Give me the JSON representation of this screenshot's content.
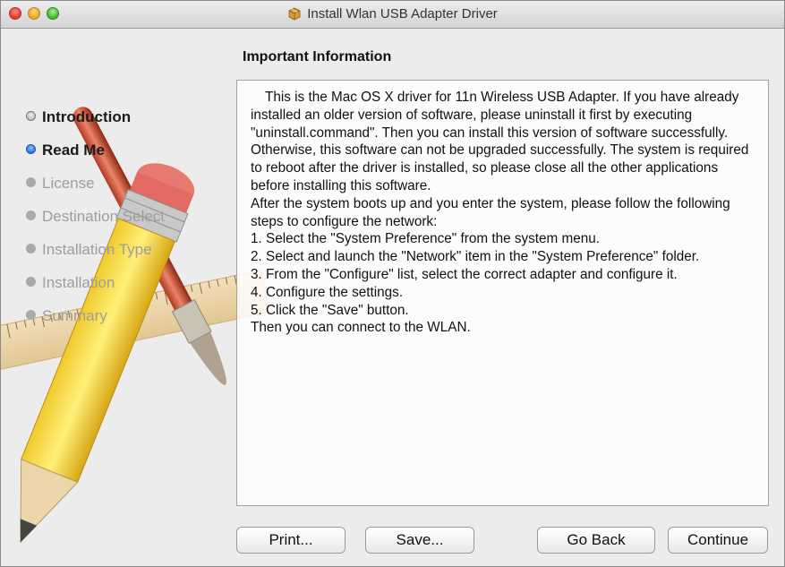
{
  "window": {
    "title": "Install Wlan USB Adapter Driver",
    "title_icon": "package-icon"
  },
  "heading": "Important Information",
  "steps": [
    {
      "label": "Introduction",
      "state": "done"
    },
    {
      "label": "Read Me",
      "state": "current"
    },
    {
      "label": "License",
      "state": "pending"
    },
    {
      "label": "Destination Select",
      "state": "pending"
    },
    {
      "label": "Installation Type",
      "state": "pending"
    },
    {
      "label": "Installation",
      "state": "pending"
    },
    {
      "label": "Summary",
      "state": "pending"
    }
  ],
  "content": {
    "intro": "This is the Mac OS X driver for 11n Wireless USB Adapter. If you have already installed an older version of software, please uninstall it first by executing \"uninstall.command\". Then you can install this version of software successfully. Otherwise, this software can not be upgraded successfully. The system is required to reboot after the driver is installed, so please close all the other applications before installing this software.",
    "after_boot": "After the system boots up and you enter the system, please follow the following steps to configure the network:",
    "steps": [
      "1. Select the \"System Preference\" from the system menu.",
      "2. Select and launch the \"Network\" item in the \"System Preference\" folder.",
      "3. From the \"Configure\" list, select the correct adapter and configure it.",
      "4. Configure the settings.",
      "5. Click the \"Save\" button."
    ],
    "closing": "Then you can connect to the WLAN."
  },
  "buttons": {
    "print": "Print...",
    "save": "Save...",
    "go_back": "Go Back",
    "continue": "Continue"
  },
  "colors": {
    "current_step_bullet": "#2b6fd6",
    "close": "#e0382d",
    "minimize": "#e6a21a",
    "maximize": "#3fb52a"
  }
}
